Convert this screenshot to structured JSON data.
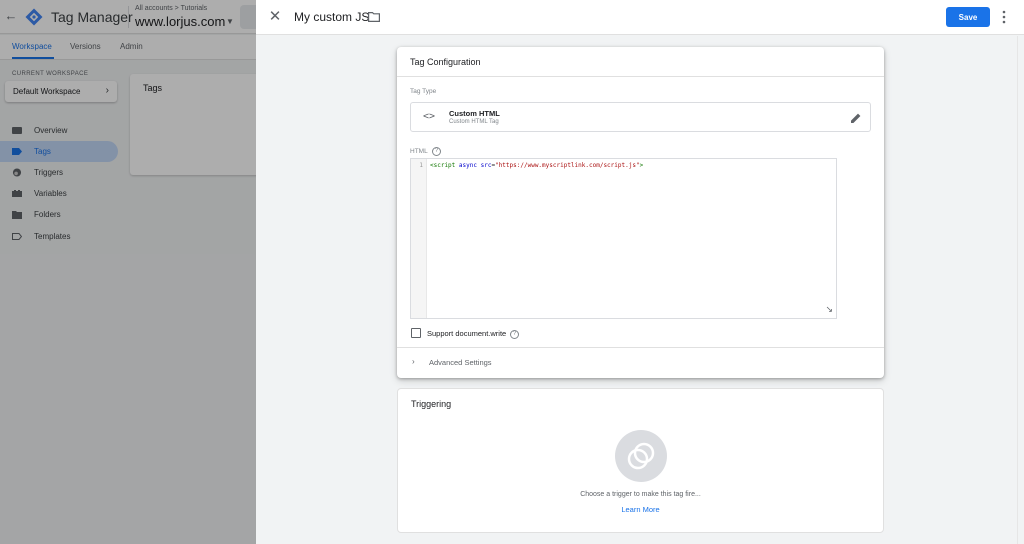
{
  "app": {
    "product_name": "Tag Manager",
    "breadcrumb": "All accounts > Tutorials",
    "container_name": "www.lorjus.com"
  },
  "nav_tabs": [
    {
      "label": "Workspace",
      "active": true
    },
    {
      "label": "Versions",
      "active": false
    },
    {
      "label": "Admin",
      "active": false
    }
  ],
  "sidebar": {
    "current_workspace_label": "CURRENT WORKSPACE",
    "workspace_name": "Default Workspace",
    "items": [
      {
        "label": "Overview",
        "icon": "overview-icon",
        "active": false
      },
      {
        "label": "Tags",
        "icon": "tag-icon",
        "active": true
      },
      {
        "label": "Triggers",
        "icon": "trigger-icon",
        "active": false
      },
      {
        "label": "Variables",
        "icon": "variables-icon",
        "active": false
      },
      {
        "label": "Folders",
        "icon": "folder-icon",
        "active": false
      },
      {
        "label": "Templates",
        "icon": "template-icon",
        "active": false
      }
    ]
  },
  "tags_card": {
    "title": "Tags"
  },
  "panel": {
    "title": "My custom JS",
    "save_label": "Save"
  },
  "tag_config": {
    "title": "Tag Configuration",
    "tag_type_label": "Tag Type",
    "tag_type_name": "Custom HTML",
    "tag_type_sub": "Custom HTML Tag",
    "html_label": "HTML",
    "code": {
      "line_number": "1",
      "tag_open": "<script",
      "attr1": "async",
      "attr2": "src",
      "equals": "=",
      "value": "\"https://www.myscriptlink.com/script.js\"",
      "close": ">"
    },
    "support_label": "Support document.write",
    "advanced_label": "Advanced Settings"
  },
  "triggering": {
    "title": "Triggering",
    "empty_text": "Choose a trigger to make this tag fire...",
    "learn_more": "Learn More"
  },
  "colors": {
    "accent": "#1a73e8",
    "active_nav_bg": "#c2d7f7"
  }
}
